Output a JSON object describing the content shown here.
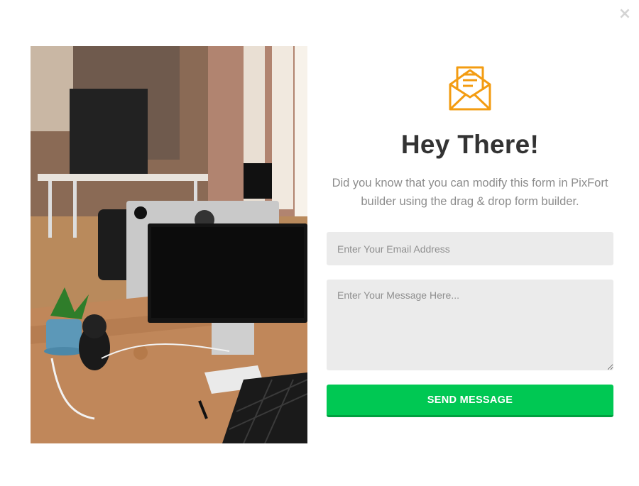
{
  "modal": {
    "close_symbol": "×",
    "close_icon": "close-icon"
  },
  "image": {
    "subject": "office desk workspace photo"
  },
  "form": {
    "icon": "envelope-letter-icon",
    "accent_color": "#f39c12",
    "title": "Hey There!",
    "description": "Did you know that you can modify this form in PixFort builder using the drag & drop form builder.",
    "email_placeholder": "Enter Your Email Address",
    "message_placeholder": "Enter Your Message Here...",
    "submit_label": "SEND MESSAGE",
    "submit_color": "#00c853"
  }
}
